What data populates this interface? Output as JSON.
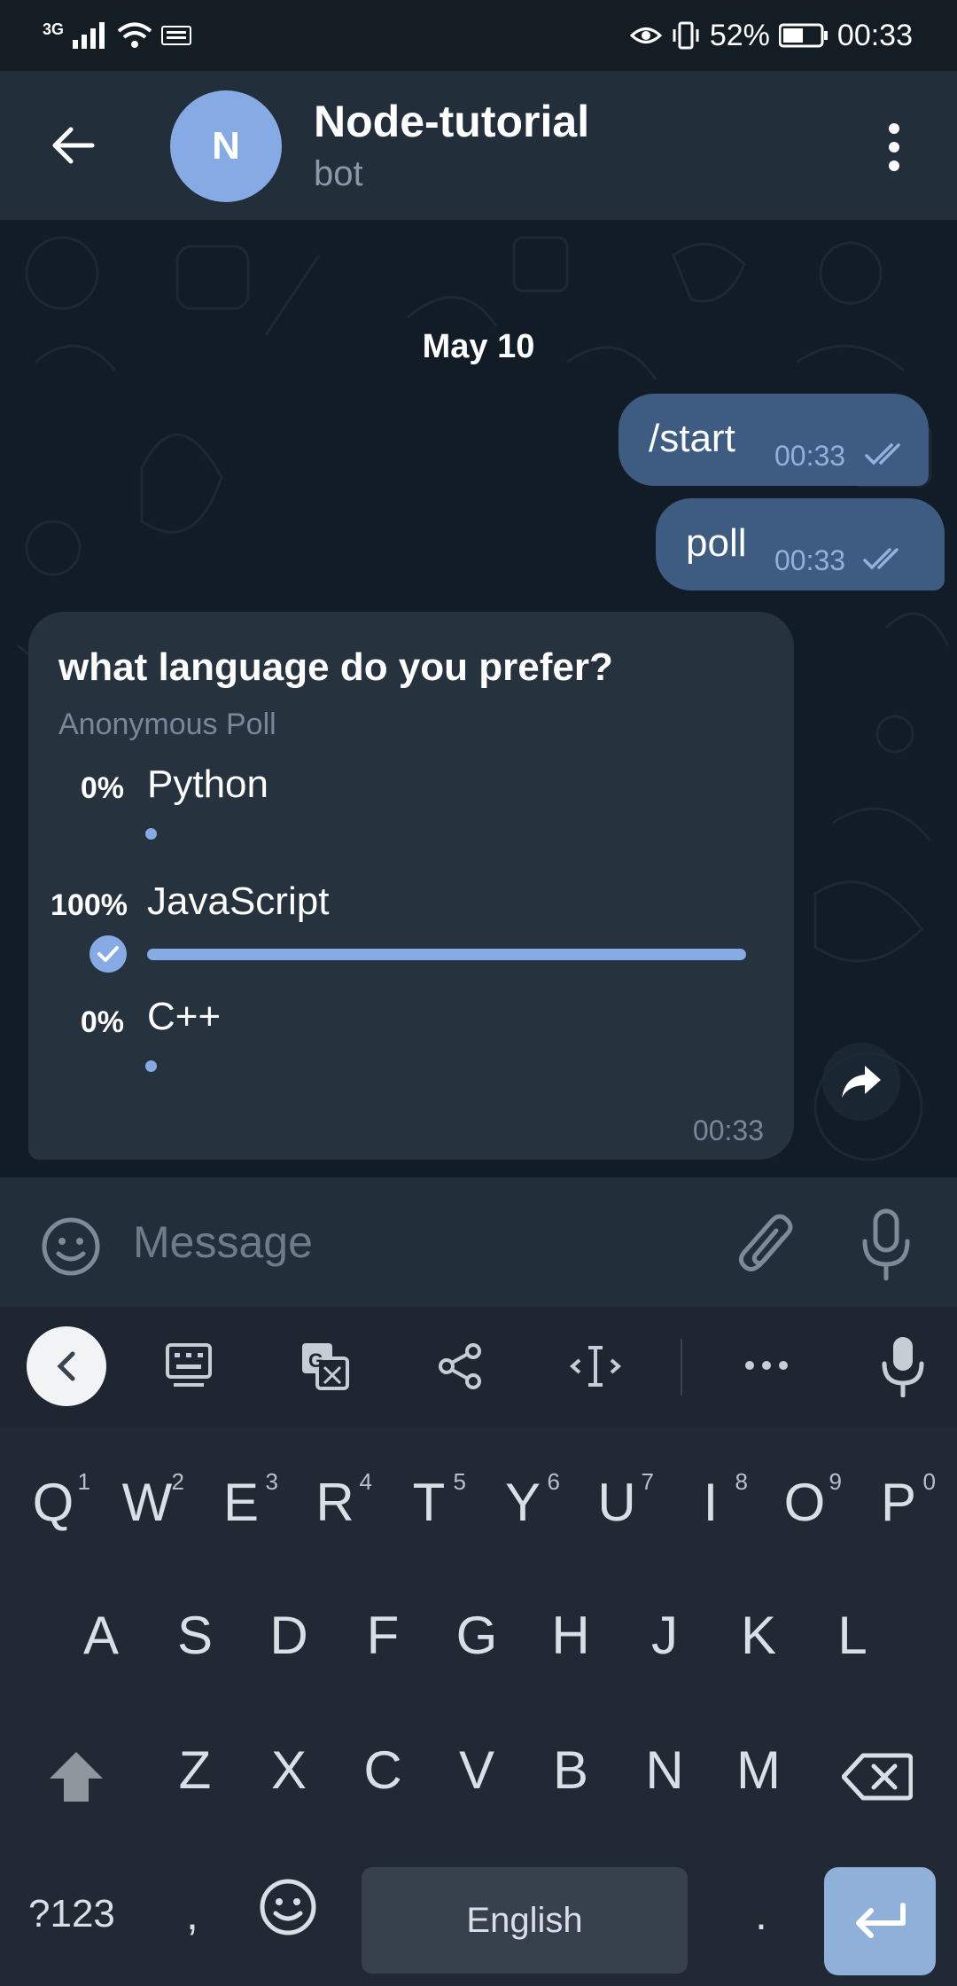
{
  "status_bar": {
    "network": "3G",
    "battery": "52%",
    "time": "00:33"
  },
  "header": {
    "avatar_letter": "N",
    "title": "Node-tutorial",
    "subtitle": "bot"
  },
  "chat": {
    "date": "May 10",
    "messages": [
      {
        "text": "/start",
        "time": "00:33"
      },
      {
        "text": "poll",
        "time": "00:33"
      }
    ],
    "poll": {
      "question": "what language do you prefer?",
      "type": "Anonymous Poll",
      "options": [
        {
          "percent": "0%",
          "label": "Python",
          "value": 0
        },
        {
          "percent": "100%",
          "label": "JavaScript",
          "value": 100,
          "selected": true
        },
        {
          "percent": "0%",
          "label": "C++",
          "value": 0
        }
      ],
      "time": "00:33"
    }
  },
  "input": {
    "placeholder": "Message"
  },
  "keyboard": {
    "row1": [
      {
        "key": "Q",
        "num": "1"
      },
      {
        "key": "W",
        "num": "2"
      },
      {
        "key": "E",
        "num": "3"
      },
      {
        "key": "R",
        "num": "4"
      },
      {
        "key": "T",
        "num": "5"
      },
      {
        "key": "Y",
        "num": "6"
      },
      {
        "key": "U",
        "num": "7"
      },
      {
        "key": "I",
        "num": "8"
      },
      {
        "key": "O",
        "num": "9"
      },
      {
        "key": "P",
        "num": "0"
      }
    ],
    "row2": [
      "A",
      "S",
      "D",
      "F",
      "G",
      "H",
      "J",
      "K",
      "L"
    ],
    "row3": [
      "Z",
      "X",
      "C",
      "V",
      "B",
      "N",
      "M"
    ],
    "symbols_key": "?123",
    "comma": ",",
    "period": ".",
    "space_label": "English"
  },
  "colors": {
    "accent": "#86aae3",
    "outgoing_bubble": "#3e5c82",
    "poll_bubble": "#26323d",
    "background": "#111c26"
  }
}
